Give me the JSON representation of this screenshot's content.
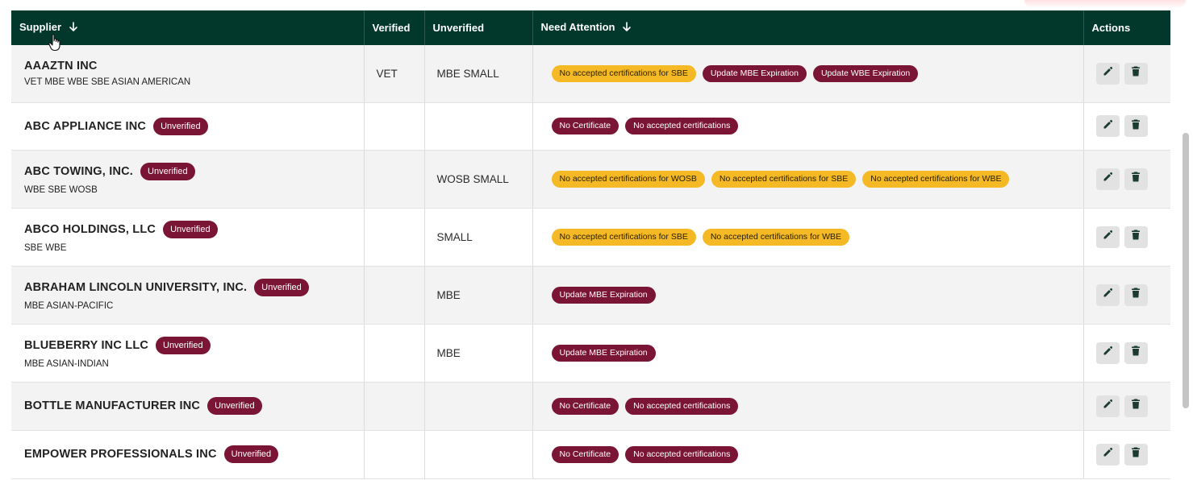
{
  "colors": {
    "header_bg": "#02382b",
    "badge_red": "#7a1535",
    "badge_yellow": "#f4b924",
    "row_alt": "#f3f3f3"
  },
  "header": {
    "supplier": "Supplier",
    "verified": "Verified",
    "unverified": "Unverified",
    "need_attention": "Need Attention",
    "actions": "Actions"
  },
  "icons": {
    "sort": "arrow-down-icon",
    "edit": "pencil-icon",
    "delete": "trash-icon",
    "cursor": "hand-pointer-icon"
  },
  "rows": [
    {
      "name": "AAAZTN INC",
      "badge": "",
      "sub": "VET MBE WBE SBE ASIAN AMERICAN",
      "verified": "VET",
      "unverified": "MBE SMALL",
      "attention": [
        {
          "text": "No accepted certifications for SBE",
          "tone": "y"
        },
        {
          "text": "Update MBE Expiration",
          "tone": "r"
        },
        {
          "text": "Update WBE Expiration",
          "tone": "r"
        }
      ]
    },
    {
      "name": "ABC APPLIANCE INC",
      "badge": "Unverified",
      "sub": "",
      "verified": "",
      "unverified": "",
      "attention": [
        {
          "text": "No Certificate",
          "tone": "r"
        },
        {
          "text": "No accepted certifications",
          "tone": "r"
        }
      ]
    },
    {
      "name": "ABC TOWING, INC.",
      "badge": "Unverified",
      "sub": "WBE SBE WOSB",
      "verified": "",
      "unverified": "WOSB SMALL",
      "attention": [
        {
          "text": "No accepted certifications for WOSB",
          "tone": "y"
        },
        {
          "text": "No accepted certifications for SBE",
          "tone": "y"
        },
        {
          "text": "No accepted certifications for WBE",
          "tone": "y"
        }
      ]
    },
    {
      "name": "ABCO HOLDINGS, LLC",
      "badge": "Unverified",
      "sub": "SBE WBE",
      "verified": "",
      "unverified": "SMALL",
      "attention": [
        {
          "text": "No accepted certifications for SBE",
          "tone": "y"
        },
        {
          "text": "No accepted certifications for WBE",
          "tone": "y"
        }
      ]
    },
    {
      "name": "ABRAHAM LINCOLN UNIVERSITY, INC.",
      "badge": "Unverified",
      "sub": "MBE ASIAN-PACIFIC",
      "verified": "",
      "unverified": "MBE",
      "attention": [
        {
          "text": "Update MBE Expiration",
          "tone": "r"
        }
      ]
    },
    {
      "name": "BLUEBERRY INC LLC",
      "badge": "Unverified",
      "sub": "MBE ASIAN-INDIAN",
      "verified": "",
      "unverified": "MBE",
      "attention": [
        {
          "text": "Update MBE Expiration",
          "tone": "r"
        }
      ]
    },
    {
      "name": "BOTTLE MANUFACTURER INC",
      "badge": "Unverified",
      "sub": "",
      "verified": "",
      "unverified": "",
      "attention": [
        {
          "text": "No Certificate",
          "tone": "r"
        },
        {
          "text": "No accepted certifications",
          "tone": "r"
        }
      ]
    },
    {
      "name": "EMPOWER PROFESSIONALS INC",
      "badge": "Unverified",
      "sub": "",
      "verified": "",
      "unverified": "",
      "attention": [
        {
          "text": "No Certificate",
          "tone": "r"
        },
        {
          "text": "No accepted certifications",
          "tone": "r"
        }
      ]
    }
  ]
}
